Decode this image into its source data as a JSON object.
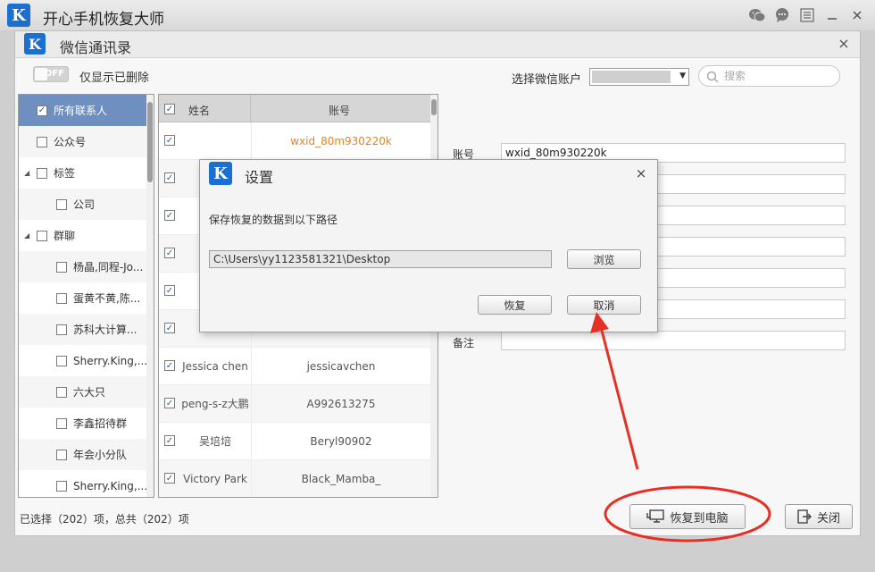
{
  "app": {
    "title": "开心手机恢复大师",
    "logo_letter": "K",
    "brand_color": "#1a6fd0"
  },
  "window": {
    "title": "微信通讯录",
    "close_glyph": "×"
  },
  "filter": {
    "toggle_state": "OFF",
    "label": "仅显示已删除"
  },
  "account_select": {
    "label": "选择微信账户"
  },
  "search": {
    "placeholder": "搜索"
  },
  "tree": {
    "items": [
      {
        "label": "所有联系人",
        "checked": true,
        "selected": true,
        "level": 0,
        "expander": ""
      },
      {
        "label": "公众号",
        "checked": false,
        "level": 0,
        "expander": ""
      },
      {
        "label": "标签",
        "checked": false,
        "level": 0,
        "expander": "◢"
      },
      {
        "label": "公司",
        "checked": false,
        "level": 1,
        "expander": ""
      },
      {
        "label": "群聊",
        "checked": false,
        "level": 0,
        "expander": "◢"
      },
      {
        "label": "杨晶,同程-Jo...",
        "checked": false,
        "level": 1,
        "expander": ""
      },
      {
        "label": "蛋黄不黄,陈...",
        "checked": false,
        "level": 1,
        "expander": ""
      },
      {
        "label": "苏科大计算...",
        "checked": false,
        "level": 1,
        "expander": ""
      },
      {
        "label": "Sherry.King,...",
        "checked": false,
        "level": 1,
        "expander": ""
      },
      {
        "label": "六大只",
        "checked": false,
        "level": 1,
        "expander": ""
      },
      {
        "label": "李鑫招待群",
        "checked": false,
        "level": 1,
        "expander": ""
      },
      {
        "label": "年会小分队",
        "checked": false,
        "level": 1,
        "expander": ""
      },
      {
        "label": "Sherry.King,...",
        "checked": false,
        "level": 1,
        "expander": ""
      }
    ]
  },
  "contacts": {
    "col_name": "姓名",
    "col_account": "账号",
    "rows": [
      {
        "name": "",
        "account": "wxid_80m930220k",
        "highlight": true
      },
      {
        "name": "",
        "account": ""
      },
      {
        "name": "",
        "account": ""
      },
      {
        "name": "",
        "account": ""
      },
      {
        "name": "",
        "account": ""
      },
      {
        "name": "",
        "account": ""
      },
      {
        "name": "Jessica chen",
        "account": "jessicavchen"
      },
      {
        "name": "peng-s-z大鹏",
        "account": "A992613275"
      },
      {
        "name": "吴培培",
        "account": "Beryl90902"
      },
      {
        "name": "Victory Park",
        "account": "Black_Mamba_"
      }
    ]
  },
  "details": {
    "account_label": "账号",
    "account_value": "wxid_80m930220k",
    "note_label": "备注",
    "note_value": ""
  },
  "status": {
    "text": "已选择（202）项，总共（202）项"
  },
  "buttons": {
    "restore_to_pc": "恢复到电脑",
    "close": "关闭"
  },
  "dialog": {
    "title": "设置",
    "prompt": "保存恢复的数据到以下路径",
    "path": "C:\\Users\\yy1123581321\\Desktop",
    "browse": "浏览",
    "restore": "恢复",
    "cancel": "取消"
  },
  "annotation": {
    "color": "#e63026"
  }
}
